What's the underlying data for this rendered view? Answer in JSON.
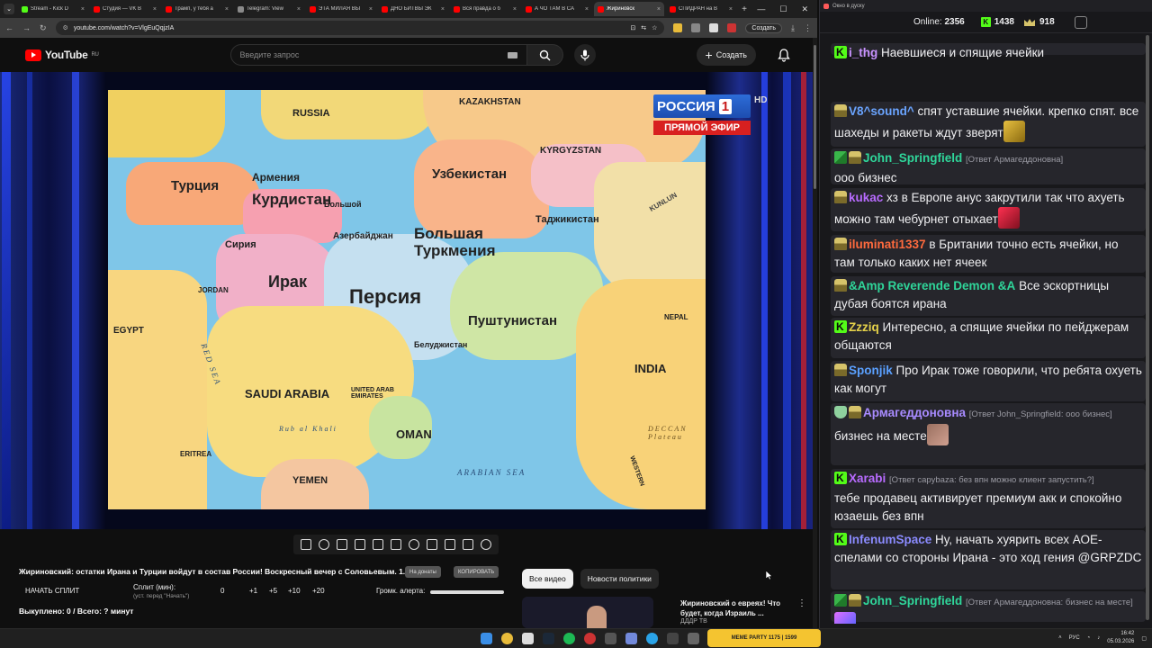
{
  "browser": {
    "tabs": [
      {
        "label": "Stream - Kick D",
        "color": "#53fc18",
        "active": false
      },
      {
        "label": "Студия — VK В",
        "color": "#ff0000",
        "active": false
      },
      {
        "label": "Трамп, у тебя а",
        "color": "#ff0000",
        "active": false
      },
      {
        "label": "Telegram: View",
        "color": "#8a8a8a",
        "active": false
      },
      {
        "label": "ЭТА МИЛАЯ ВЫ",
        "color": "#ff0000",
        "active": false
      },
      {
        "label": "ДНО БИТВЫ ЭК",
        "color": "#ff0000",
        "active": false
      },
      {
        "label": "Вся правда о б",
        "color": "#ff0000",
        "active": false
      },
      {
        "label": "А ЧО ТАМ В СА",
        "color": "#ff0000",
        "active": false
      },
      {
        "label": "Жириновск",
        "color": "#ff0000",
        "active": true
      },
      {
        "label": "СПИДРАН на В",
        "color": "#ff0000",
        "active": false
      }
    ],
    "newtab": "+",
    "close_x": "×",
    "url": "youtube.com/watch?v=VlgEuQqjzIA",
    "update_label": "Создать"
  },
  "youtube": {
    "logo_text": "YouTube",
    "logo_region": "RU",
    "search_placeholder": "Введите запрос",
    "create_label": "Создать",
    "video": {
      "channel_name": "РОССИЯ",
      "channel_number": "1",
      "live_label": "ПРЯМОЙ ЭФИР",
      "hd_label": "HD",
      "map_labels": {
        "russia": "RUSSIA",
        "kazakhstan": "KAZAKHSTAN",
        "turkey": "Турция",
        "armenia": "Армения",
        "kurdistan": "Курдистан",
        "bolshoy": "Большой",
        "uzbekistan": "Узбекистан",
        "kyrgyzstan": "KYRGYZSTAN",
        "tajikistan": "Таджикистан",
        "azerbaijan": "Азербайджан",
        "turkmenia": "Большая Туркмения",
        "syria": "Сирия",
        "iraq": "Ирак",
        "persia": "Персия",
        "pushtunistan": "Пуштунистан",
        "beluchistan": "Белуджистан",
        "egypt": "EGYPT",
        "jordan": "JORDAN",
        "saudi": "SAUDI ARABIA",
        "uae": "UNITED ARAB EMIRATES",
        "oman": "OMAN",
        "yemen": "YEMEN",
        "india": "INDIA",
        "nepal": "NEPAL",
        "arabian_sea": "ARABIAN SEA",
        "red_sea": "RED SEA",
        "eritrea": "ERITREA",
        "kunlun": "KUNLUN",
        "rub_khali": "Rub al Khali",
        "deccan": "DECCAN Plateau",
        "western": "WESTERN"
      }
    },
    "title": "Жириновский: остатки Ирана и Турции войдут в состав России! Воскресный вечер с Соловьевым. 1...",
    "pill_1": "На донаты",
    "pill_2": "КОПИРОВАТЬ",
    "split": {
      "start_label": "НАЧАТЬ СПЛИТ",
      "split_min_label": "Сплит (мин):",
      "split_hint": "(уст. перед \"Начать\")",
      "zero": "0",
      "p1": "+1",
      "p5": "+5",
      "p10": "+10",
      "p20": "+20",
      "alert_label": "Громк. алерта:",
      "alert_volume": 1.0
    },
    "bought": "Выкуплено: 0 / Всего: ? минут",
    "chips": [
      "Все видео",
      "Новости политики"
    ],
    "rec": {
      "title": "Жириновский о евреях! Что будет, когда Израиль ...",
      "channel": "ДДДР ТВ"
    }
  },
  "chat": {
    "window_title": "Окно в дуску",
    "online_label": "Online:",
    "online_count": "2356",
    "kick_count": "1438",
    "crown_count": "918",
    "messages": [
      {
        "badges": [
          "kick"
        ],
        "user": "i_thg",
        "color": "#c993ff",
        "reply": "",
        "text": "Наевшиеся и спящие ячейки"
      },
      {
        "badges": [
          "crown"
        ],
        "user": "V8^sound^",
        "color": "#6aa4ff",
        "reply": "",
        "text": "спят уставшие ячейки. крепко спят. все шахеды и ракеты ждут зверят"
      },
      {
        "badges": [
          "gift",
          "crown"
        ],
        "user": "John_Springfield",
        "color": "#2fd69a",
        "reply": "[Ответ Армагеддоновна]",
        "text": "ооо бизнес"
      },
      {
        "badges": [
          "crown"
        ],
        "user": "kukac",
        "color": "#b86bff",
        "reply": "",
        "text": "хз в Европе анус закрутили так что ахуеть можно там чебурнет отыхает"
      },
      {
        "badges": [
          "crown"
        ],
        "user": "iluminati1337",
        "color": "#ff6a3d",
        "reply": "",
        "text": "в Британии точно есть ячейки, но там только каких нет ячеек"
      },
      {
        "badges": [
          "crown"
        ],
        "user": "&Amp Reverende Demon &A",
        "color": "#2fd69a",
        "reply": "",
        "text": "Все эскортницы дубая боятся ирана"
      },
      {
        "badges": [
          "kick"
        ],
        "user": "Zzziq",
        "color": "#e6d24a",
        "reply": "",
        "text": "Интересно, а спящие ячейки по пейджерам общаются"
      },
      {
        "badges": [
          "crown"
        ],
        "user": "Sponjik",
        "color": "#5aa0ff",
        "reply": "",
        "text": "Про Ирак тоже говорили, что ребята охуеть как могут"
      },
      {
        "badges": [
          "shield",
          "crown"
        ],
        "user": "Армагеддоновна",
        "color": "#a88bff",
        "reply": "[Ответ John_Springfield: ооо бизнес]",
        "text": "бизнес на месте"
      },
      {
        "badges": [
          "kick"
        ],
        "user": "Xarabi",
        "color": "#b86bff",
        "reply": "[Ответ capybaza: без впн можно клиент запустить?]",
        "text": "тебе продавец активирует премиум акк и спокойно юзаешь без впн"
      },
      {
        "badges": [
          "kick"
        ],
        "user": "InfenumSpace",
        "color": "#8b8bff",
        "reply": "",
        "text": "Ну, начать хуярить всех АОЕ-спелами со стороны Ирана - это ход гения @GRPZDC"
      },
      {
        "badges": [
          "gift",
          "crown"
        ],
        "user": "John_Springfield",
        "color": "#2fd69a",
        "reply": "[Ответ Армагеддоновна: бизнес на месте]",
        "text": ""
      }
    ]
  },
  "taskbar": {
    "meme_label": "MEME PARTY",
    "meme_stats": "1175 | 1599",
    "lang": "РУС",
    "time": "16:42",
    "date": "05.03.2026"
  }
}
